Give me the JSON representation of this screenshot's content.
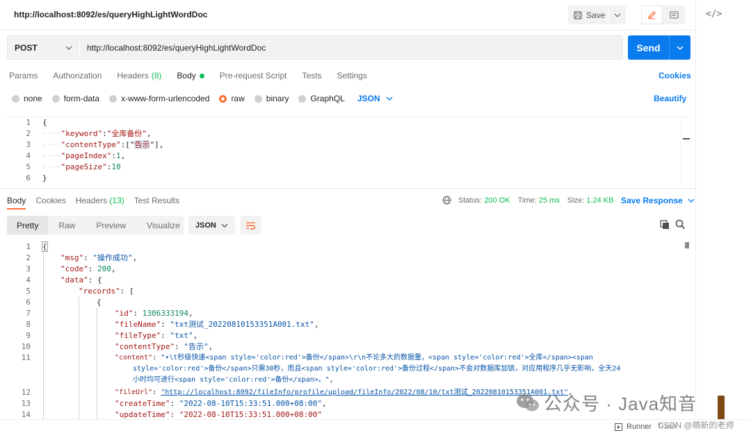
{
  "titlebar": {
    "title": "http://localhost:8092/es/queryHighLightWordDoc",
    "save_label": "Save"
  },
  "request": {
    "method": "POST",
    "url": "http://localhost:8092/es/queryHighLightWordDoc",
    "send_label": "Send"
  },
  "req_tabs": {
    "params": "Params",
    "authorization": "Authorization",
    "headers": "Headers",
    "headers_count": "(8)",
    "body": "Body",
    "prerequest": "Pre-request Script",
    "tests": "Tests",
    "settings": "Settings",
    "cookies": "Cookies"
  },
  "body_types": {
    "none": "none",
    "form_data": "form-data",
    "urlencoded": "x-www-form-urlencoded",
    "raw": "raw",
    "binary": "binary",
    "graphql": "GraphQL",
    "format": "JSON",
    "beautify": "Beautify"
  },
  "request_body": {
    "line_numbers": [
      "1",
      "2",
      "3",
      "4",
      "5",
      "6"
    ],
    "open": "{",
    "k1": "\"keyword\"",
    "v1": "\"全库备份\"",
    "k2": "\"contentType\"",
    "v2a": "[\"",
    "v2h": "告示",
    "v2b": "\"]",
    "k3": "\"pageIndex\"",
    "v3": "1",
    "k4": "\"pageSize\"",
    "v4": "10",
    "close": "}"
  },
  "resp_tabs": {
    "body": "Body",
    "cookies": "Cookies",
    "headers": "Headers",
    "headers_count": "(13)",
    "tests": "Test Results",
    "status_label": "Status:",
    "status_value": "200 OK",
    "time_label": "Time:",
    "time_value": "25 ms",
    "size_label": "Size:",
    "size_value": "1.24 KB",
    "save_response": "Save Response"
  },
  "view": {
    "pretty": "Pretty",
    "raw": "Raw",
    "preview": "Preview",
    "visualize": "Visualize",
    "format": "JSON"
  },
  "response_body": {
    "line_numbers": [
      "1",
      "2",
      "3",
      "4",
      "5",
      "6",
      "7",
      "8",
      "9",
      "10",
      "11",
      "12",
      "13",
      "14"
    ],
    "l1": "{",
    "msg_k": "\"msg\"",
    "msg_v": "\"操作成功\"",
    "code_k": "\"code\"",
    "code_v": "200",
    "data_k": "\"data\"",
    "data_v": "{",
    "records_k": "\"records\"",
    "records_v": "[",
    "obj_open": "{",
    "id_k": "\"id\"",
    "id_v": "1306333194",
    "fn_k": "\"fileName\"",
    "fn_v": "\"txt测试_20220810153351A001.txt\"",
    "ft_k": "\"fileType\"",
    "ft_v": "\"txt\"",
    "ct_k": "\"contentType\"",
    "ct_v": "\"告示\"",
    "content_k": "\"content\"",
    "content_v1": "\"•\\t秒级快速<span style='color:red'>备份</span>\\r\\n不论多大的数据量，<span style='color:red'>全库</span><span",
    "content_v2": "style='color:red'>备份</span>只需30秒，而且<span style='color:red'>备份过程</span>不会对数据库加锁，对应用程序几乎无影响，全天24",
    "content_v3": "小时均可进行<span style='color:red'>备份</span>。\"",
    "fu_k": "\"fileUrl\"",
    "fu_v": "\"http://localhost:8092/fileInfo/profile/upload/fileInfo/2022/08/10/txt测试_20220810153351A001.txt\"",
    "cr_k": "\"createTime\"",
    "cr_v": "\"2022-08-10T15:33:51.000+08:00\"",
    "up_partial": "\"updateTime\": \"2022-08-10T15:33:51.000+08:00\""
  },
  "footer": {
    "runner": "Runner",
    "trash": "Trash",
    "csdn": "CSDN @萌新的老师"
  },
  "watermark": {
    "text": "公众号 · Java知音"
  },
  "colors": {
    "accent": "#ff6c37",
    "primary": "#097bed",
    "success": "#0cbb52"
  }
}
